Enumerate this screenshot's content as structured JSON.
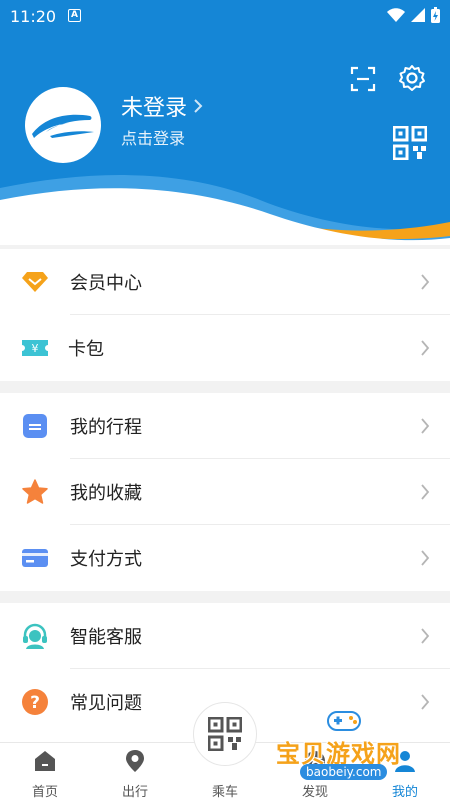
{
  "status_bar": {
    "time": "11:20",
    "notification_letter": "A"
  },
  "profile": {
    "title": "未登录",
    "subtitle": "点击登录"
  },
  "menu_groups": [
    {
      "items": [
        {
          "label": "会员中心",
          "icon": "diamond-icon"
        },
        {
          "label": "卡包",
          "icon": "ticket-icon"
        }
      ]
    },
    {
      "items": [
        {
          "label": "我的行程",
          "icon": "trip-icon"
        },
        {
          "label": "我的收藏",
          "icon": "star-icon"
        },
        {
          "label": "支付方式",
          "icon": "card-icon"
        }
      ]
    },
    {
      "items": [
        {
          "label": "智能客服",
          "icon": "headset-icon"
        },
        {
          "label": "常见问题",
          "icon": "question-icon"
        }
      ]
    }
  ],
  "bottom_nav": {
    "items": [
      {
        "label": "首页",
        "icon": "home-icon"
      },
      {
        "label": "出行",
        "icon": "location-icon"
      },
      {
        "label": "乘车",
        "icon": "qrcode-icon"
      },
      {
        "label": "发现",
        "icon": "discover-icon"
      },
      {
        "label": "我的",
        "icon": "user-icon"
      }
    ],
    "active": "我的"
  },
  "watermark": {
    "text": "宝贝游戏网",
    "url": "baobeiy.com"
  },
  "colors": {
    "primary": "#1586d6",
    "accent_orange": "#f5a21a",
    "background": "#f2f2f2"
  }
}
